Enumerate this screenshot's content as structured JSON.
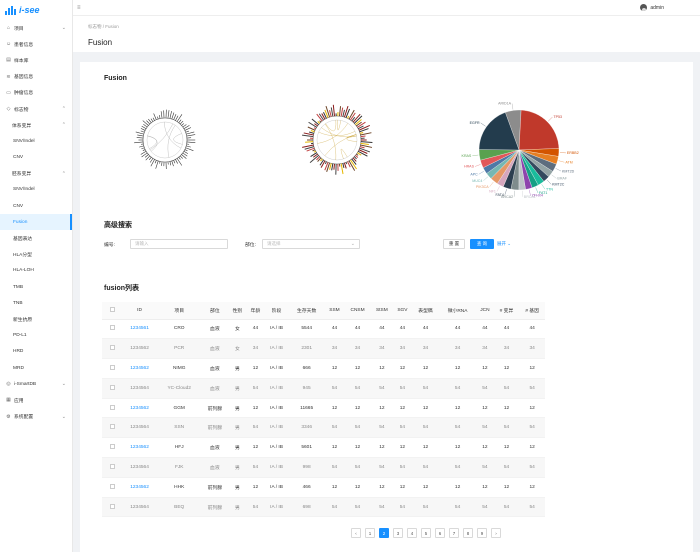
{
  "app": {
    "title": "i-see"
  },
  "sidebar": {
    "items": [
      {
        "label": "项目",
        "icon": "home-icon",
        "level": 0,
        "caret": "⌄"
      },
      {
        "label": "患者信息",
        "icon": "user-icon",
        "level": 0
      },
      {
        "label": "样本库",
        "icon": "archive-icon",
        "level": 0
      },
      {
        "label": "基因信息",
        "icon": "dna-icon",
        "level": 0
      },
      {
        "label": "肿瘤信息",
        "icon": "file-icon",
        "level": 0
      },
      {
        "label": "标志物",
        "icon": "tag-icon",
        "level": 0,
        "caret": "⌃"
      },
      {
        "label": "体系变异",
        "level": 1,
        "caret": "⌃"
      },
      {
        "label": "SNV/Indel",
        "level": 2
      },
      {
        "label": "CNV",
        "level": 2
      },
      {
        "label": "胚系变异",
        "level": 1,
        "caret": "⌃"
      },
      {
        "label": "SNV/Indel",
        "level": 2
      },
      {
        "label": "CNV",
        "level": 2
      },
      {
        "label": "Fusion",
        "level": 2,
        "active": true
      },
      {
        "label": "基因表达",
        "level": 2
      },
      {
        "label": "HLA分型",
        "level": 2
      },
      {
        "label": "HLA-LOH",
        "level": 2
      },
      {
        "label": "TMB",
        "level": 2
      },
      {
        "label": "TNB",
        "level": 2
      },
      {
        "label": "新生抗原",
        "level": 2
      },
      {
        "label": "PD-L1",
        "level": 2
      },
      {
        "label": "HRD",
        "level": 2
      },
      {
        "label": "MRD",
        "level": 2
      },
      {
        "label": "i-SmartDB",
        "icon": "database-icon",
        "level": 0,
        "caret": "⌄"
      },
      {
        "label": "应用",
        "icon": "app-icon",
        "level": 0
      },
      {
        "label": "系统配置",
        "icon": "gear-icon",
        "level": 0,
        "caret": "⌄"
      }
    ]
  },
  "header": {
    "user": "admin"
  },
  "page": {
    "breadcrumb": "标志物 / Fusion",
    "title": "Fusion"
  },
  "fusion_section": {
    "title": "Fusion"
  },
  "search": {
    "title": "高级搜索",
    "id_label": "编号:",
    "id_placeholder": "请输入",
    "site_label": "部位:",
    "site_placeholder": "请选择",
    "reset_label": "重 置",
    "query_label": "查 询",
    "expand_label": "展开 ⌄"
  },
  "table": {
    "title": "fusion列表",
    "columns": [
      "ID",
      "项目",
      "部位",
      "性别",
      "年龄",
      "阶段",
      "生存天数",
      "SSM",
      "CNSM",
      "StSM",
      "SGV",
      "表型稿",
      "微小RNA",
      "JCN",
      "# 变异",
      "# 基因"
    ],
    "rows": [
      [
        "1234561",
        "CRO",
        "血液",
        "女",
        "44",
        "IA / IB",
        "5544",
        "44",
        "44",
        "44",
        "44",
        "44",
        "44",
        "44",
        "44",
        "44"
      ],
      [
        "1234562",
        "PCR",
        "血液",
        "女",
        "34",
        "IA / IB",
        "2301",
        "34",
        "34",
        "34",
        "34",
        "34",
        "34",
        "34",
        "34",
        "34"
      ],
      [
        "1234562",
        "NIMG",
        "血液",
        "男",
        "12",
        "IA / IB",
        "666",
        "12",
        "12",
        "12",
        "12",
        "12",
        "12",
        "12",
        "12",
        "12"
      ],
      [
        "1234564",
        "YC-Cloud2",
        "血液",
        "男",
        "54",
        "IA / IB",
        "945",
        "54",
        "54",
        "54",
        "54",
        "54",
        "54",
        "54",
        "54",
        "54"
      ],
      [
        "1234562",
        "GGM",
        "前列腺",
        "男",
        "12",
        "IA / IB",
        "11665",
        "12",
        "12",
        "12",
        "12",
        "12",
        "12",
        "12",
        "12",
        "12"
      ],
      [
        "1234564",
        "SSN",
        "前列腺",
        "男",
        "54",
        "IA / IB",
        "3346",
        "54",
        "54",
        "54",
        "54",
        "54",
        "54",
        "54",
        "54",
        "54"
      ],
      [
        "1234562",
        "HFJ",
        "血液",
        "男",
        "12",
        "IA / IB",
        "5601",
        "12",
        "12",
        "12",
        "12",
        "12",
        "12",
        "12",
        "12",
        "12"
      ],
      [
        "1234564",
        "FJK",
        "血液",
        "男",
        "54",
        "IA / IB",
        "998",
        "54",
        "54",
        "54",
        "54",
        "54",
        "54",
        "54",
        "54",
        "54"
      ],
      [
        "1234562",
        "HHK",
        "前列腺",
        "男",
        "12",
        "IA / IB",
        "466",
        "12",
        "12",
        "12",
        "12",
        "12",
        "12",
        "12",
        "12",
        "12"
      ],
      [
        "1234564",
        "BEQ",
        "前列腺",
        "男",
        "54",
        "IA / IB",
        "698",
        "54",
        "54",
        "54",
        "54",
        "54",
        "54",
        "54",
        "54",
        "54"
      ]
    ]
  },
  "pagination": {
    "prev": "‹",
    "pages": [
      "1",
      "2",
      "3",
      "4",
      "5",
      "6",
      "7",
      "8",
      "9"
    ],
    "current": "2",
    "next": "›"
  },
  "pie": {
    "labels": [
      "ARID1A",
      "TP53",
      "ERBB2",
      "ATM",
      "KMT2D",
      "BRAF",
      "KMT2C",
      "TTN",
      "FAT1",
      "ZFHX4",
      "BRCA1",
      "BRCA2",
      "FAT4",
      "NF1",
      "PIK3CA",
      "MUC4",
      "APC",
      "HRAS",
      "KRAS",
      "EGFR"
    ],
    "values": [
      6,
      22,
      3,
      3,
      3,
      2.5,
      2.5,
      2.5,
      2.5,
      2.5,
      2.5,
      3,
      3,
      2.5,
      3,
      2.5,
      2.5,
      3,
      4,
      18
    ],
    "colors": [
      "#8c8c8c",
      "#c0392b",
      "#d35400",
      "#e67e22",
      "#5d6d7e",
      "#95a5a6",
      "#34495e",
      "#1abc9c",
      "#16a085",
      "#8e44ad",
      "#bdc3c7",
      "#7f8c8d",
      "#2c3e50",
      "#d5a6bd",
      "#e59866",
      "#76b7b2",
      "#4e79a7",
      "#e15759",
      "#59a14f",
      "#233c4d"
    ]
  }
}
